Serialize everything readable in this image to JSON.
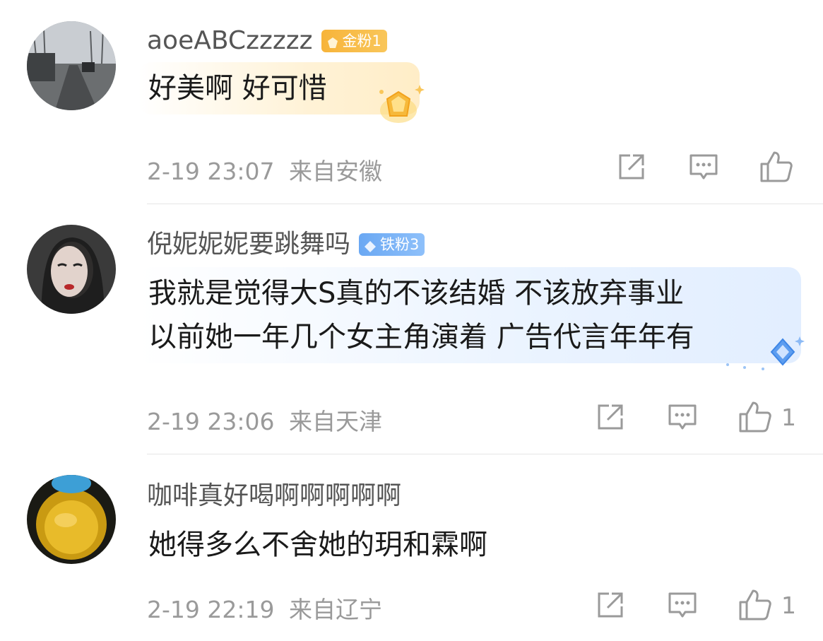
{
  "comments": [
    {
      "username": "aoeABCzzzzz",
      "badge": {
        "label": "金粉1",
        "type": "gold"
      },
      "content": [
        "好美啊 好可惜"
      ],
      "date": "2-19 23:07",
      "location": "来自安徽",
      "likes": ""
    },
    {
      "username": "倪妮妮妮要跳舞吗",
      "badge": {
        "label": "铁粉3",
        "type": "iron"
      },
      "content": [
        "我就是觉得大S真的不该结婚 不该放弃事业",
        "以前她一年几个女主角演着 广告代言年年有"
      ],
      "date": "2-19 23:06",
      "location": "来自天津",
      "likes": "1"
    },
    {
      "username": "咖啡真好喝啊啊啊啊啊",
      "badge": null,
      "content": [
        "她得多么不舍她的玥和霖啊"
      ],
      "date": "2-19 22:19",
      "location": "来自辽宁",
      "likes": "1"
    }
  ],
  "colors": {
    "gold_badge": "#f7b43a",
    "iron_badge": "#6aa8f3",
    "meta_text": "#9a9a9a",
    "icon": "#9a9a9a"
  },
  "icons": [
    "share-icon",
    "comment-icon",
    "like-icon"
  ]
}
